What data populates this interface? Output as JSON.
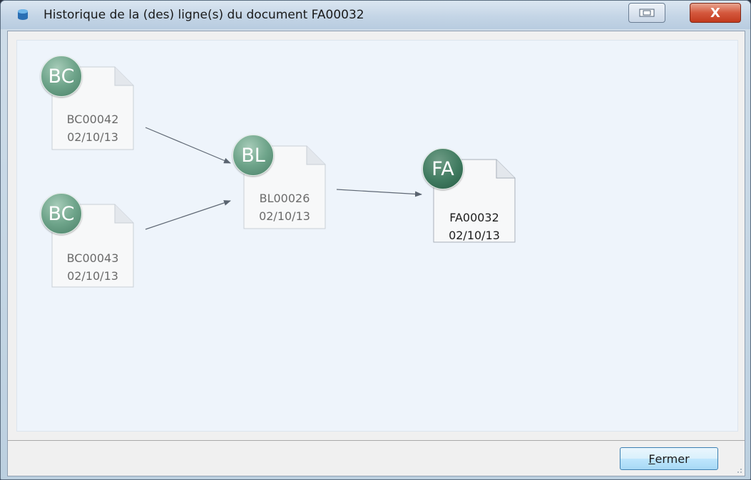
{
  "window": {
    "title": "Historique de la (des) ligne(s) du document FA00032",
    "close_label": "X"
  },
  "documents": [
    {
      "badge": "BC",
      "number": "BC00042",
      "date": "02/10/13"
    },
    {
      "badge": "BC",
      "number": "BC00043",
      "date": "02/10/13"
    },
    {
      "badge": "BL",
      "number": "BL00026",
      "date": "02/10/13"
    },
    {
      "badge": "FA",
      "number": "FA00032",
      "date": "02/10/13",
      "current": true
    }
  ],
  "links": [
    {
      "from": "BC00042",
      "to": "BL00026"
    },
    {
      "from": "BC00043",
      "to": "BL00026"
    },
    {
      "from": "BL00026",
      "to": "FA00032"
    }
  ],
  "footer": {
    "close_button_accel": "F",
    "close_button_rest": "ermer"
  },
  "colors": {
    "badge_green": "#6ea48a",
    "canvas_bg": "#eef4fb",
    "button_border": "#3c7fb1"
  }
}
